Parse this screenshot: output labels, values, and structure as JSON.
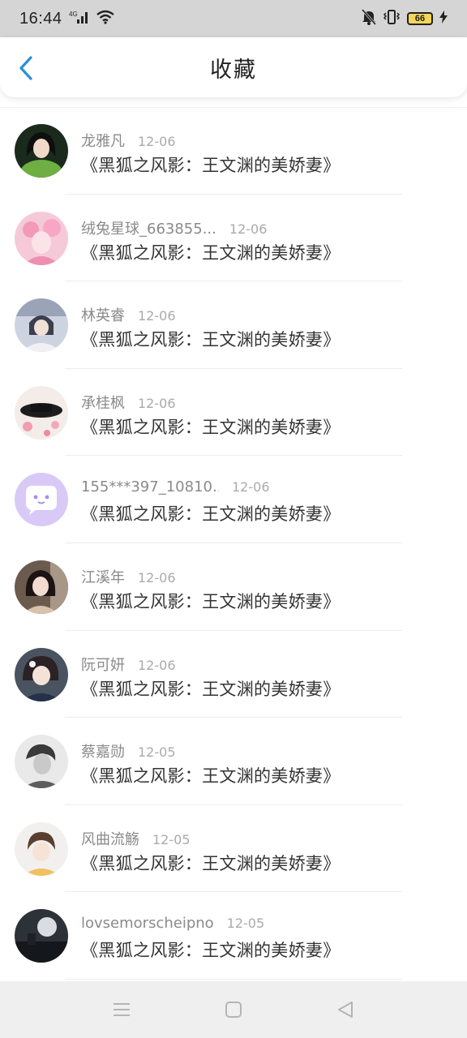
{
  "status_bar": {
    "time": "16:44",
    "network": "4G",
    "battery": "66"
  },
  "header": {
    "title": "收藏",
    "back_icon": "chevron-left-icon"
  },
  "accent_color": "#2b8fd9",
  "items": [
    {
      "name": "龙雅凡",
      "date": "12-06",
      "book": "《黑狐之风影：王文渊的美娇妻》"
    },
    {
      "name": "绒兔星球_663855...",
      "date": "12-06",
      "book": "《黑狐之风影：王文渊的美娇妻》"
    },
    {
      "name": "林英睿",
      "date": "12-06",
      "book": "《黑狐之风影：王文渊的美娇妻》"
    },
    {
      "name": "承桂枫",
      "date": "12-06",
      "book": "《黑狐之风影：王文渊的美娇妻》"
    },
    {
      "name": "155***397_10810...",
      "date": "12-06",
      "book": "《黑狐之风影：王文渊的美娇妻》"
    },
    {
      "name": "江溪年",
      "date": "12-06",
      "book": "《黑狐之风影：王文渊的美娇妻》"
    },
    {
      "name": "阮可妍",
      "date": "12-06",
      "book": "《黑狐之风影：王文渊的美娇妻》"
    },
    {
      "name": "蔡嘉勋",
      "date": "12-05",
      "book": "《黑狐之风影：王文渊的美娇妻》"
    },
    {
      "name": "风曲流觞",
      "date": "12-05",
      "book": "《黑狐之风影：王文渊的美娇妻》"
    },
    {
      "name": "lovsemorscheipno",
      "date": "12-05",
      "book": "《黑狐之风影：王文渊的美娇妻》"
    }
  ],
  "nav_bar": {
    "menu_icon": "menu-icon",
    "home_icon": "home-square-icon",
    "back_icon": "back-triangle-icon"
  }
}
